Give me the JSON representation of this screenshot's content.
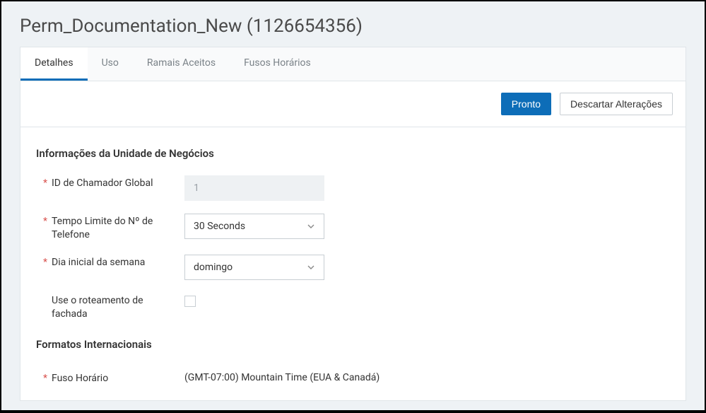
{
  "page_title": "Perm_Documentation_New (1126654356)",
  "tabs": {
    "detalhes": "Detalhes",
    "uso": "Uso",
    "ramais": "Ramais Aceitos",
    "fusos": "Fusos Horários"
  },
  "actions": {
    "pronto": "Pronto",
    "descartar": "Descartar Alterações"
  },
  "section_business": "Informações da Unidade de Negócios",
  "fields": {
    "caller_id_label": "ID de Chamador Global",
    "caller_id_value": "1",
    "timeout_label": "Tempo Limite do Nº de Telefone",
    "timeout_value": "30 Seconds",
    "start_day_label": "Dia inicial da semana",
    "start_day_value": "domingo",
    "facade_label": "Use o roteamento de fachada"
  },
  "section_intl": "Formatos Internacionais",
  "tz_label": "Fuso Horário",
  "tz_value": "(GMT-07:00) Mountain Time (EUA & Canadá)"
}
